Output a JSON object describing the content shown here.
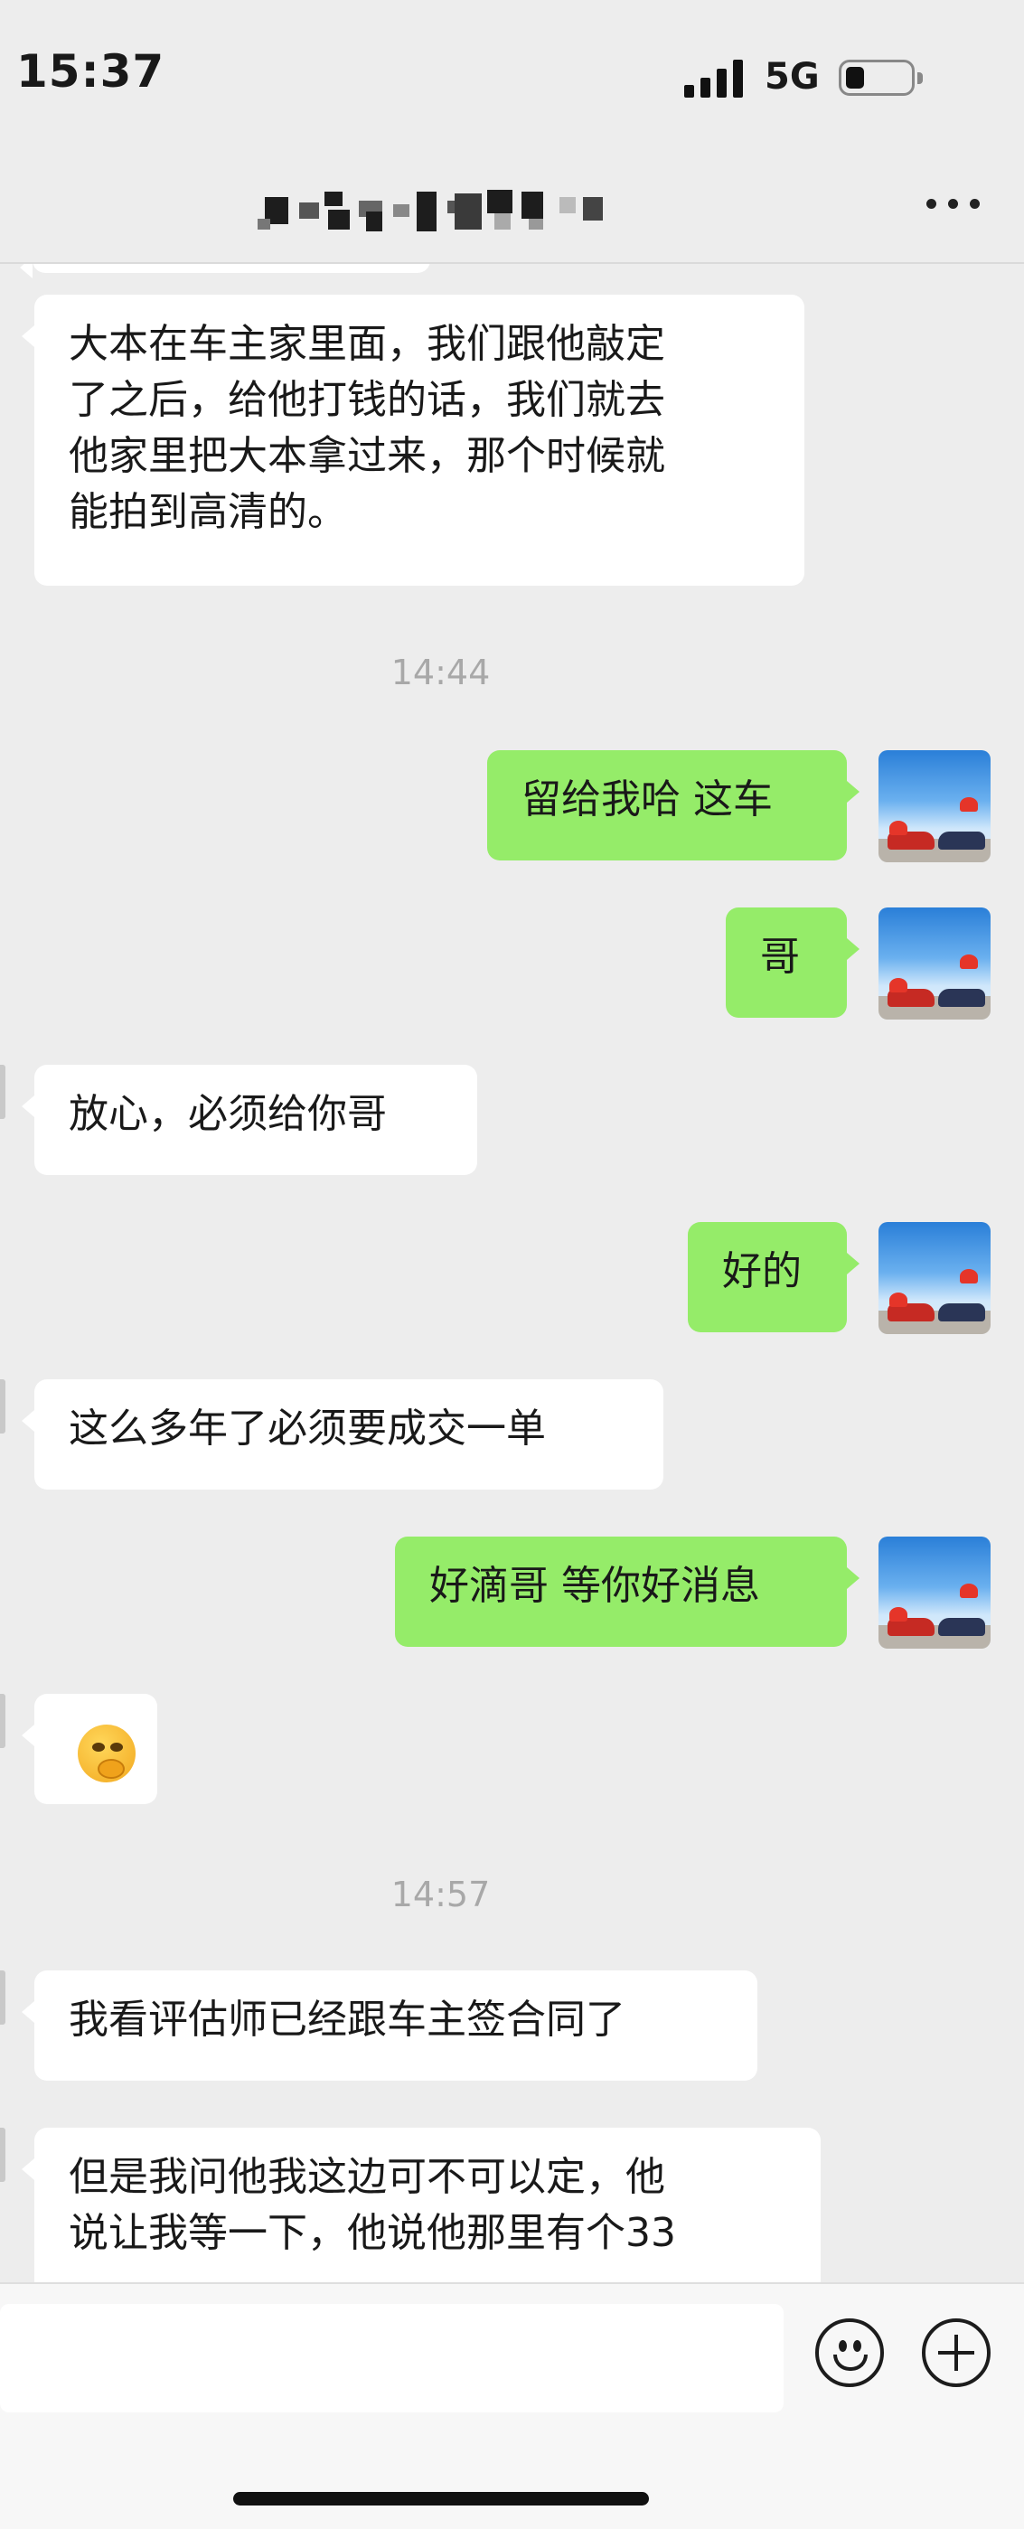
{
  "status_bar": {
    "time": "15:37",
    "network": "5G"
  },
  "header": {
    "more_icon": "more-dots-icon"
  },
  "messages": [
    {
      "side": "in",
      "text": "大本在车主家里面，我们跟他敲定\n了之后，给他打钱的话，我们就去\n他家里把大本拿过来，那个时候就\n能拍到高清的。"
    },
    {
      "type": "time",
      "text": "14:44"
    },
    {
      "side": "out",
      "text": "留给我哈 这车"
    },
    {
      "side": "out",
      "text": "哥"
    },
    {
      "side": "in",
      "text": "放心，必须给你哥"
    },
    {
      "side": "out",
      "text": "好的"
    },
    {
      "side": "in",
      "text": "这么多年了必须要成交一单"
    },
    {
      "side": "out",
      "text": "好滴哥 等你好消息"
    },
    {
      "side": "in",
      "type": "emoji",
      "emoji": "thinking-face-emoji"
    },
    {
      "type": "time",
      "text": "14:57"
    },
    {
      "side": "in",
      "text": "我看评估师已经跟车主签合同了"
    },
    {
      "side": "in",
      "text": "但是我问他我这边可不可以定，他\n说让我等一下，他说他那里有个33"
    }
  ],
  "input_bar": {
    "emoji_icon": "smiley-icon",
    "plus_icon": "plus-circle-icon"
  },
  "colors": {
    "outgoing_bubble": "#95ec69",
    "incoming_bubble": "#ffffff",
    "background": "#ededed"
  }
}
